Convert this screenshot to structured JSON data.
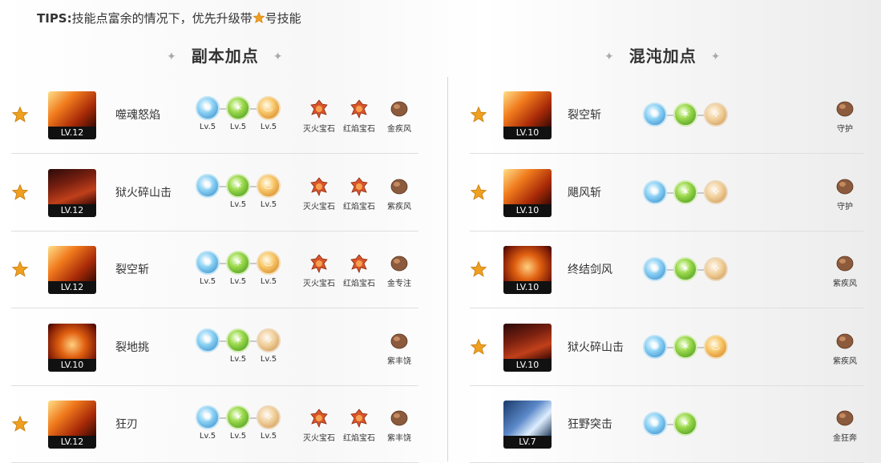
{
  "tips": {
    "prefix": "TIPS:",
    "text_before": "技能点富余的情况下，优先升级带",
    "text_after": "号技能"
  },
  "left": {
    "title": "副本加点",
    "rows": [
      {
        "starred": true,
        "lv": "LV.12",
        "name": "噬魂怒焰",
        "orbs": [
          [
            "blue",
            "Lv.5"
          ],
          [
            "green",
            "Lv.5"
          ],
          [
            "orange",
            "Lv.5"
          ]
        ],
        "gems": [
          [
            "red",
            "灭火宝石"
          ],
          [
            "red",
            "红焰宝石"
          ],
          [
            "brown",
            "金疾风"
          ]
        ]
      },
      {
        "starred": true,
        "lv": "LV.12",
        "name": "狱火碎山击",
        "orbs": [
          [
            "blue",
            ""
          ],
          [
            "green",
            "Lv.5"
          ],
          [
            "orange",
            "Lv.5"
          ]
        ],
        "gems": [
          [
            "red",
            "灭火宝石"
          ],
          [
            "red",
            "红焰宝石"
          ],
          [
            "brown",
            "紫疾风"
          ]
        ]
      },
      {
        "starred": true,
        "lv": "LV.12",
        "name": "裂空斩",
        "orbs": [
          [
            "blue",
            "Lv.5"
          ],
          [
            "green",
            "Lv.5"
          ],
          [
            "orange",
            "Lv.5"
          ]
        ],
        "gems": [
          [
            "red",
            "灭火宝石"
          ],
          [
            "red",
            "红焰宝石"
          ],
          [
            "brown",
            "金专注"
          ]
        ]
      },
      {
        "starred": false,
        "lv": "LV.10",
        "name": "裂地挑",
        "orbs": [
          [
            "blue",
            ""
          ],
          [
            "green",
            "Lv.5"
          ],
          [
            "tan",
            "Lv.5"
          ]
        ],
        "gems": [
          [
            "none",
            ""
          ],
          [
            "none",
            ""
          ],
          [
            "brown",
            "紫丰饶"
          ]
        ]
      },
      {
        "starred": true,
        "lv": "LV.12",
        "name": "狂刃",
        "orbs": [
          [
            "blue",
            "Lv.5"
          ],
          [
            "green",
            "Lv.5"
          ],
          [
            "tan",
            "Lv.5"
          ]
        ],
        "gems": [
          [
            "red",
            "灭火宝石"
          ],
          [
            "red",
            "红焰宝石"
          ],
          [
            "brown",
            "紫丰饶"
          ]
        ]
      }
    ]
  },
  "right": {
    "title": "混沌加点",
    "rows": [
      {
        "starred": true,
        "lv": "LV.10",
        "name": "裂空斩",
        "orbs": [
          "blue",
          "green",
          "tan"
        ],
        "gem": "守护"
      },
      {
        "starred": true,
        "lv": "LV.10",
        "name": "飓风斩",
        "orbs": [
          "blue",
          "green",
          "tan"
        ],
        "gem": "守护"
      },
      {
        "starred": true,
        "lv": "LV.10",
        "name": "终结剑风",
        "orbs": [
          "blue",
          "green",
          "tan"
        ],
        "gem": "紫疾风"
      },
      {
        "starred": true,
        "lv": "LV.10",
        "name": "狱火碎山击",
        "orbs": [
          "blue",
          "green",
          "orange"
        ],
        "gem": "紫疾风"
      },
      {
        "starred": false,
        "lv": "LV.7",
        "name": "狂野突击",
        "orbs": [
          "blue",
          "green"
        ],
        "gem": "金狂奔"
      }
    ]
  },
  "colors": {
    "star": "#f0a020",
    "gem_red": "#d8542a",
    "gem_brown": "#8c5a3c"
  },
  "icon_names": [
    "star-icon",
    "skill-icon",
    "rune-orb-icon",
    "gem-icon"
  ]
}
